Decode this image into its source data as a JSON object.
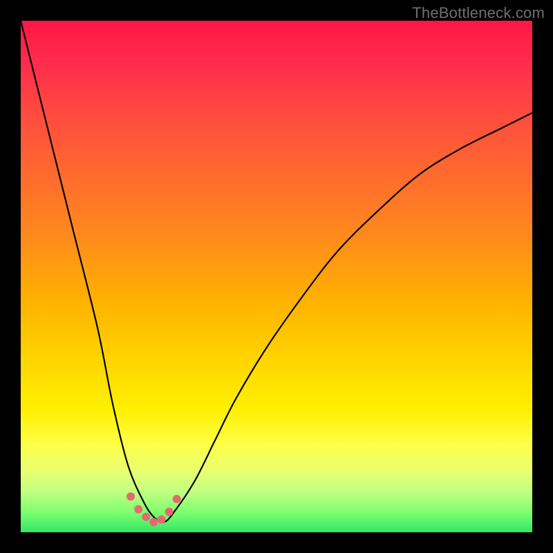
{
  "watermark": "TheBottleneck.com",
  "chart_data": {
    "type": "line",
    "title": "",
    "xlabel": "",
    "ylabel": "",
    "xlim": [
      0,
      100
    ],
    "ylim": [
      0,
      100
    ],
    "background_gradient": {
      "top_color": "#ff1744",
      "bottom_color": "#33e666",
      "note": "red (worst) at top to green (best) at bottom"
    },
    "series": [
      {
        "name": "bottleneck-curve",
        "color": "#000000",
        "x": [
          0,
          5,
          10,
          15,
          18,
          21,
          24,
          26,
          28,
          30,
          34,
          38,
          42,
          48,
          55,
          62,
          70,
          78,
          86,
          94,
          100
        ],
        "y_pct_from_top": [
          0,
          20,
          40,
          60,
          75,
          87,
          94,
          97,
          98,
          96,
          90,
          82,
          74,
          64,
          54,
          45,
          37,
          30,
          25,
          21,
          18
        ]
      }
    ],
    "markers": {
      "name": "trough-markers",
      "color": "#e46a6f",
      "radius": 6,
      "x": [
        21.5,
        23.0,
        24.5,
        26.0,
        27.5,
        29.0,
        30.5
      ],
      "y_pct_from_top": [
        93.0,
        95.5,
        97.0,
        98.0,
        97.5,
        96.0,
        93.5
      ]
    }
  }
}
